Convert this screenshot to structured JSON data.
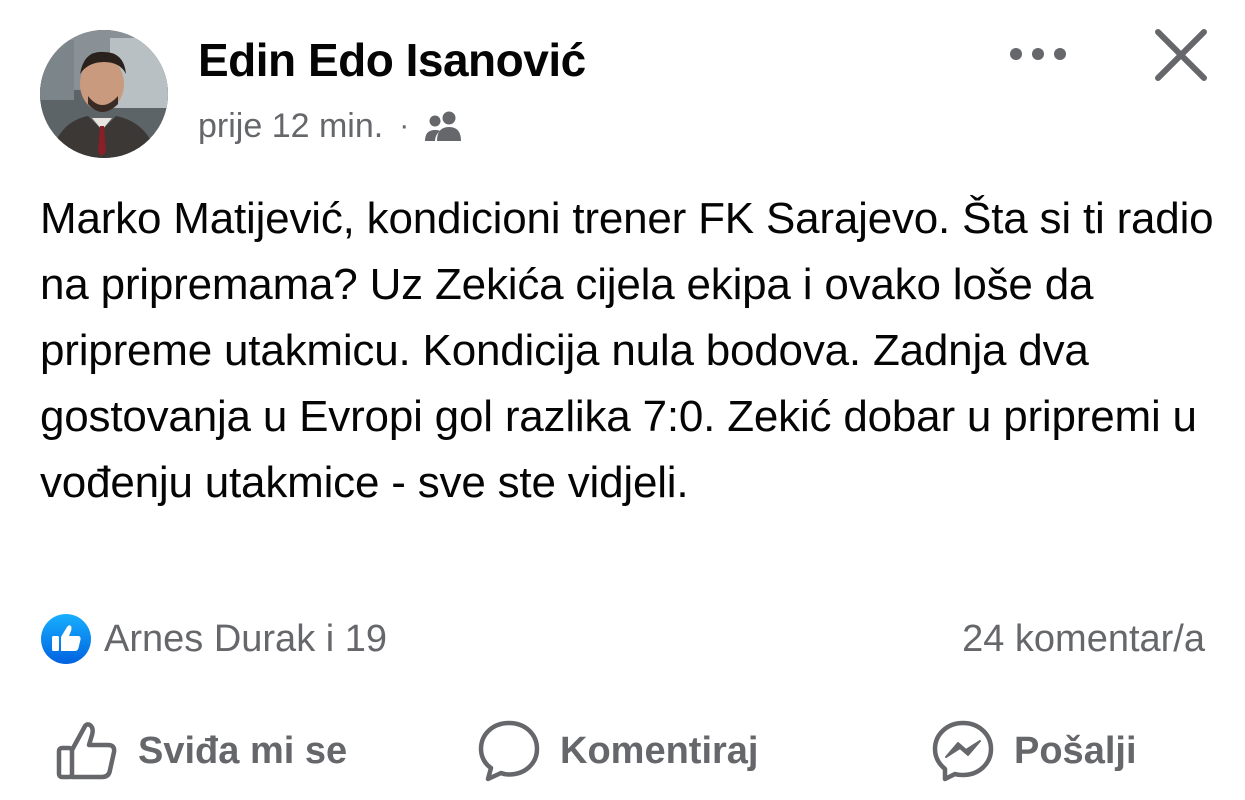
{
  "post": {
    "author": "Edin Edo Isanović",
    "timestamp": "prije 12 min.",
    "separator": "·",
    "audience_icon": "friends-icon",
    "text": "Marko Matijević, kondicioni trener FK Sarajevo. Šta si ti radio na pripremama? Uz Zekića cijela ekipa i ovako loše da pripreme utakmicu. Kondicija nula bodova. Zadnja dva gostovanja u Evropi gol razlika 7:0. Zekić dobar u pripremi u vođenju utakmice - sve ste vidjeli."
  },
  "header": {
    "more_icon": "more-horizontal-icon",
    "close_icon": "close-icon"
  },
  "stats": {
    "reactions": "Arnes Durak i 19",
    "comments": "24 komentar/a"
  },
  "actions": {
    "like": "Sviđa mi se",
    "comment": "Komentiraj",
    "send": "Pošalji"
  },
  "colors": {
    "text": "#050505",
    "secondary": "#65676b",
    "like_blue": "#1877f2"
  }
}
